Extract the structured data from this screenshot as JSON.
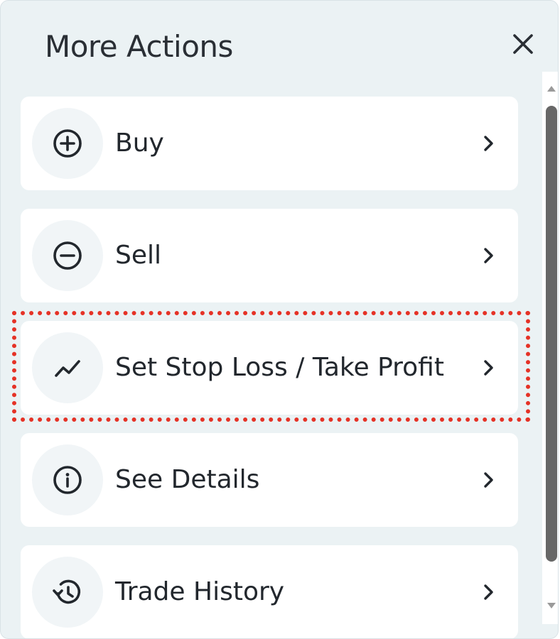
{
  "header": {
    "title": "More Actions",
    "close_icon": "close-icon"
  },
  "actions": [
    {
      "label": "Buy",
      "icon": "plus-circle-icon"
    },
    {
      "label": "Sell",
      "icon": "minus-circle-icon"
    },
    {
      "label": "Set Stop Loss / Take Profit",
      "icon": "trend-line-icon",
      "highlighted": true
    },
    {
      "label": "See Details",
      "icon": "info-circle-icon"
    },
    {
      "label": "Trade History",
      "icon": "history-icon"
    }
  ],
  "colors": {
    "panel_background": "#ebf2f4",
    "card_background": "#ffffff",
    "text": "#22272d",
    "highlight_border": "#e53226",
    "scroll_thumb": "#676767"
  }
}
